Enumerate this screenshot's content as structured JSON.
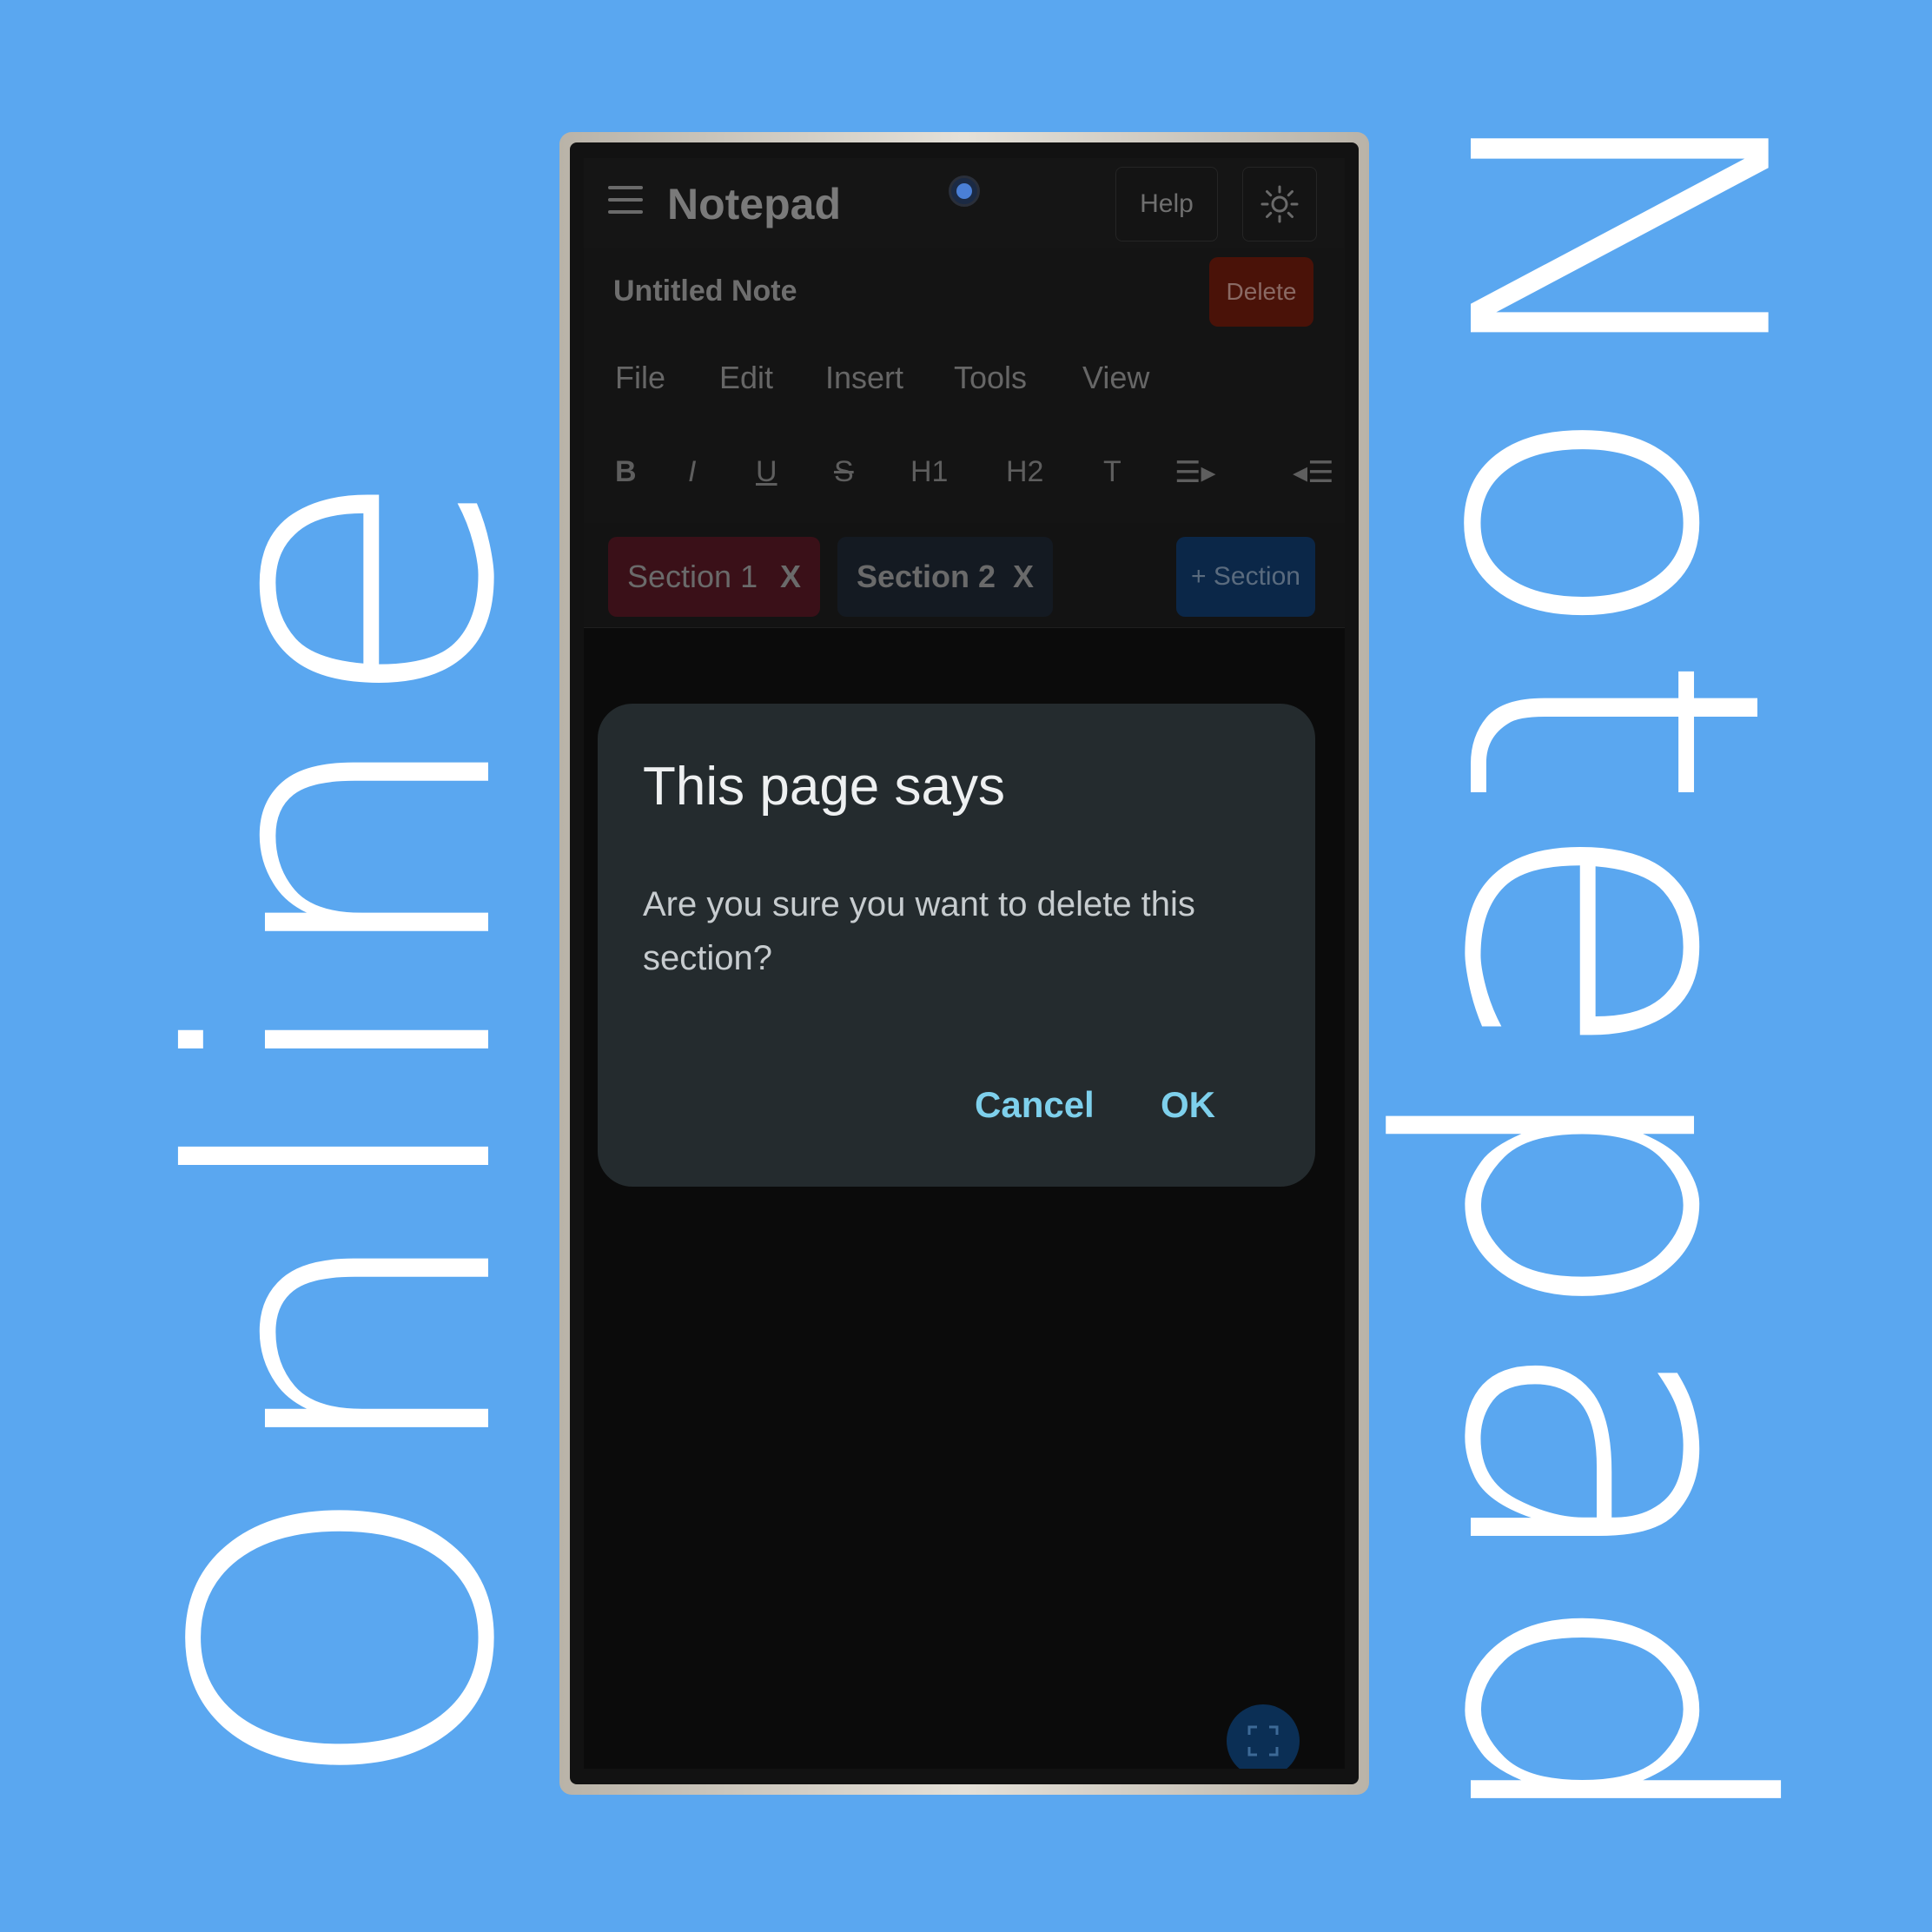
{
  "promo": {
    "left_text": "Online",
    "right_text": "Notepad"
  },
  "app": {
    "title": "Notepad",
    "help_label": "Help",
    "note_title": "Untitled Note",
    "delete_label": "Delete",
    "menu": [
      "File",
      "Edit",
      "Insert",
      "Tools",
      "View"
    ],
    "format": [
      "B",
      "I",
      "U",
      "S",
      "H1",
      "H2",
      "T",
      "☰▸",
      "◂☰"
    ],
    "sections": [
      {
        "label": "Section 1",
        "close": "X",
        "color": "#3a1018"
      },
      {
        "label": "Section 2",
        "close": "X",
        "color": "#141a22"
      }
    ],
    "add_section_label": "+ Section"
  },
  "dialog": {
    "title": "This page says",
    "message": "Are you sure you want to delete this section?",
    "cancel_label": "Cancel",
    "ok_label": "OK"
  },
  "icons": {
    "menu": "hamburger-icon",
    "theme": "sun-icon",
    "fullscreen": "fullscreen-icon"
  },
  "colors": {
    "background": "#5aa7f0",
    "dialog_bg": "#242b2e",
    "dialog_accent": "#7ed0ec",
    "delete": "#4a1208"
  }
}
